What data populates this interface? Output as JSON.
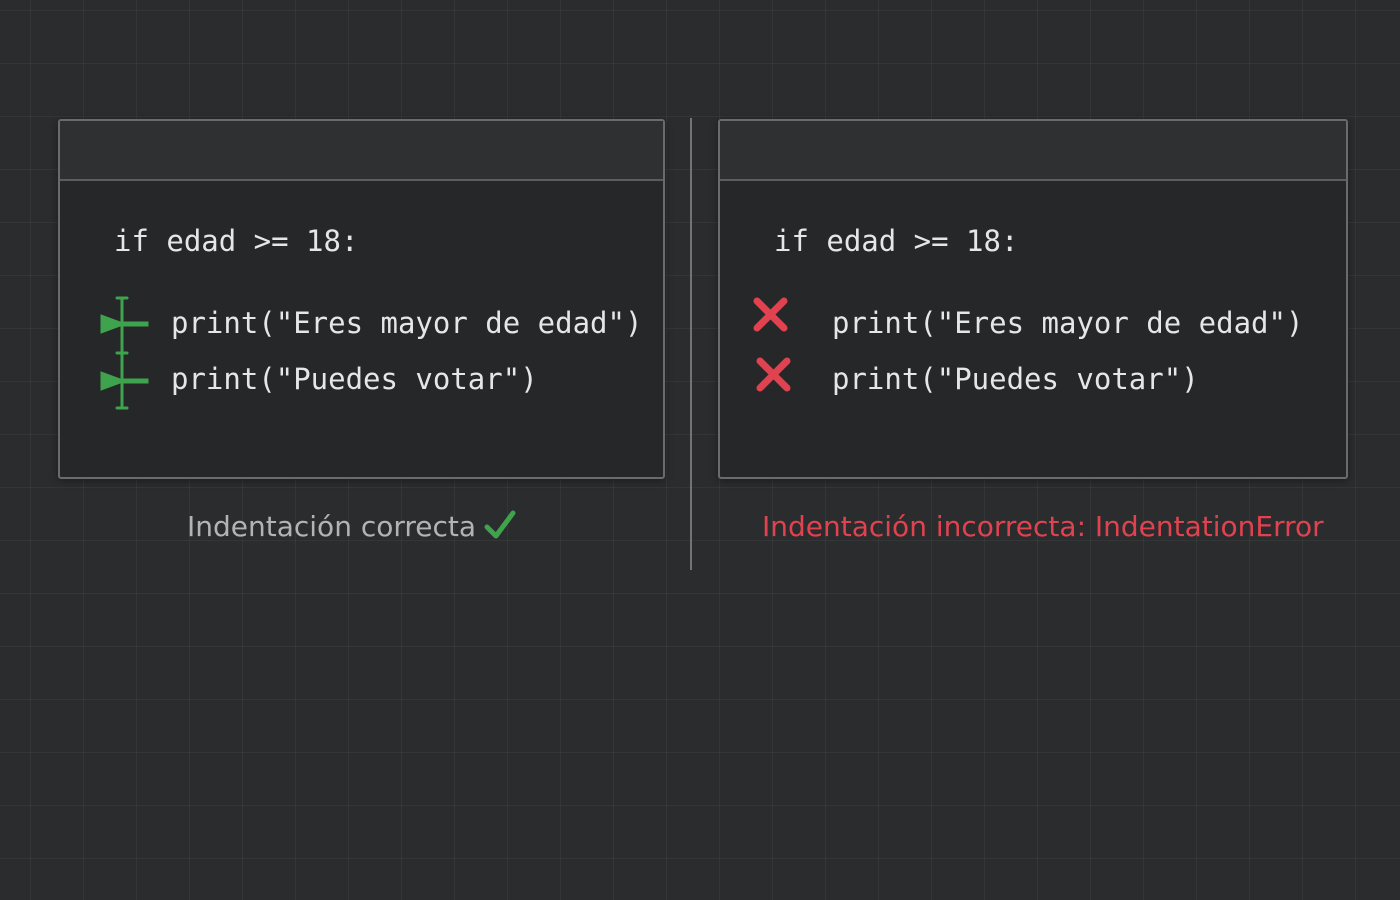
{
  "left_panel": {
    "code": {
      "line1": "if edad >= 18:",
      "line2": "print(\"Eres mayor de edad\")",
      "line3": "print(\"Puedes votar\")"
    },
    "caption": "Indentación correcta",
    "marker_icon": "indent-arrow-icon",
    "status_icon": "checkmark-icon",
    "accent_color": "#3fa34d"
  },
  "right_panel": {
    "code": {
      "line1": "if edad >= 18:",
      "line2": "print(\"Eres mayor de edad\")",
      "line3": "print(\"Puedes votar\")"
    },
    "caption": "Indentación incorrecta: IndentationError",
    "marker_icon": "x-mark-icon",
    "accent_color": "#e0434f"
  }
}
